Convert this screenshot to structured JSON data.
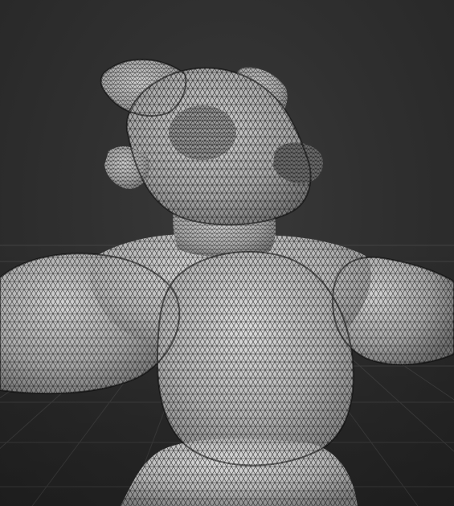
{
  "viewport": {
    "mode": "3d-viewport-wireframe-overlay",
    "background_color": "#2e2e2e",
    "grid_color": "#4a4a4a",
    "mesh_color": "#c9c9c9",
    "wire_color": "#111111"
  },
  "object": {
    "kind": "sculpted-character-mesh",
    "overlay": "wireframe"
  }
}
